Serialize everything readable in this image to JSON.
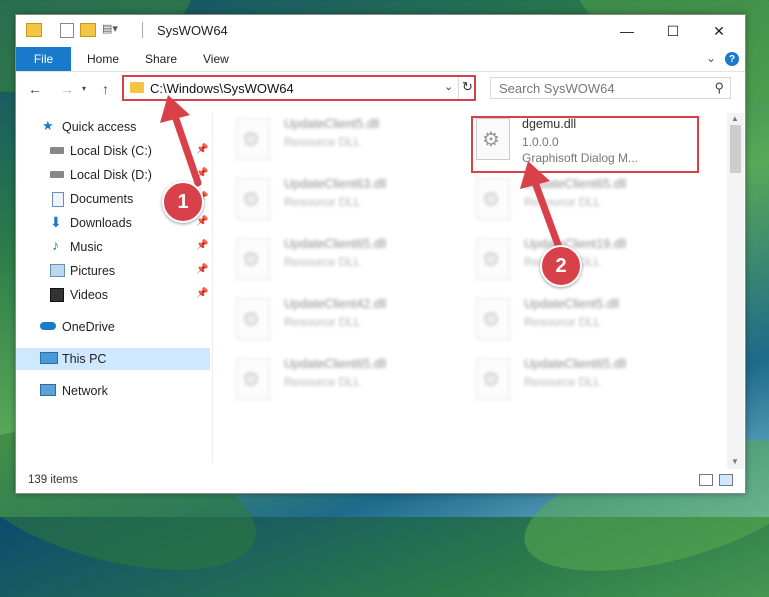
{
  "window": {
    "title": "SysWOW64"
  },
  "ribbon": {
    "tabs": [
      "File",
      "Home",
      "Share",
      "View"
    ],
    "help": "?"
  },
  "nav": {
    "address": "C:\\Windows\\SysWOW64",
    "search_placeholder": "Search SysWOW64"
  },
  "sidebar": {
    "items": [
      {
        "label": "Quick access"
      },
      {
        "label": "Local Disk (C:)"
      },
      {
        "label": "Local Disk (D:)"
      },
      {
        "label": "Documents"
      },
      {
        "label": "Downloads"
      },
      {
        "label": "Music"
      },
      {
        "label": "Pictures"
      },
      {
        "label": "Videos"
      },
      {
        "label": "OneDrive"
      },
      {
        "label": "This PC"
      },
      {
        "label": "Network"
      }
    ]
  },
  "files": [
    {
      "name": "UpdateClient5.dll",
      "desc": "Resource DLL"
    },
    {
      "name": "dgemu.dll",
      "version": "1.0.0.0",
      "desc": "Graphisoft Dialog M..."
    },
    {
      "name": "UpdateClient63.dll",
      "desc": "Resource DLL"
    },
    {
      "name": "UpdateClient65.dll",
      "desc": "Resource DLL"
    },
    {
      "name": "UpdateClient65.dll",
      "desc": "Resource DLL"
    },
    {
      "name": "UpdateClient19.dll",
      "desc": "Resource DLL"
    },
    {
      "name": "UpdateClient42.dll",
      "desc": "Resource DLL"
    },
    {
      "name": "UpdateClient5.dll",
      "desc": "Resource DLL"
    },
    {
      "name": "UpdateClient65.dll",
      "desc": "Resource DLL"
    },
    {
      "name": "UpdateClient65.dll",
      "desc": "Resource DLL"
    }
  ],
  "status": {
    "count": "139 items"
  },
  "annotations": {
    "badge1": "1",
    "badge2": "2"
  },
  "colors": {
    "accent": "#1979ca",
    "highlight": "#d9414a",
    "selected": "#cde8ff"
  }
}
